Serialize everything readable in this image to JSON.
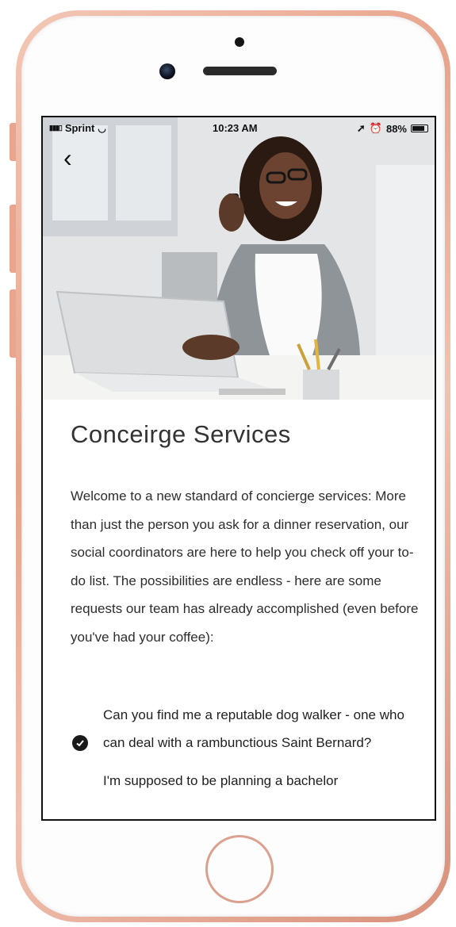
{
  "status_bar": {
    "carrier": "Sprint",
    "time": "10:23 AM",
    "battery_percent": "88%"
  },
  "hero": {
    "image": "woman-on-phone-at-laptop"
  },
  "page": {
    "title": "Conceirge Services",
    "intro": "Welcome to a new standard of concierge services: More than just the person you ask for a dinner reservation, our social coordinators are here to help you check off your to-do list. The possibilities are endless - here are some requests our team has already accomplished (even before you've had your coffee):",
    "requests": [
      {
        "text": "Can you find me a reputable dog walker - one who can deal with a rambunctious Saint Bernard?"
      },
      {
        "text": "I'm supposed to be planning a bachelor"
      }
    ]
  },
  "colors": {
    "frame": "#e8a48c",
    "text": "#2d2d2d"
  }
}
